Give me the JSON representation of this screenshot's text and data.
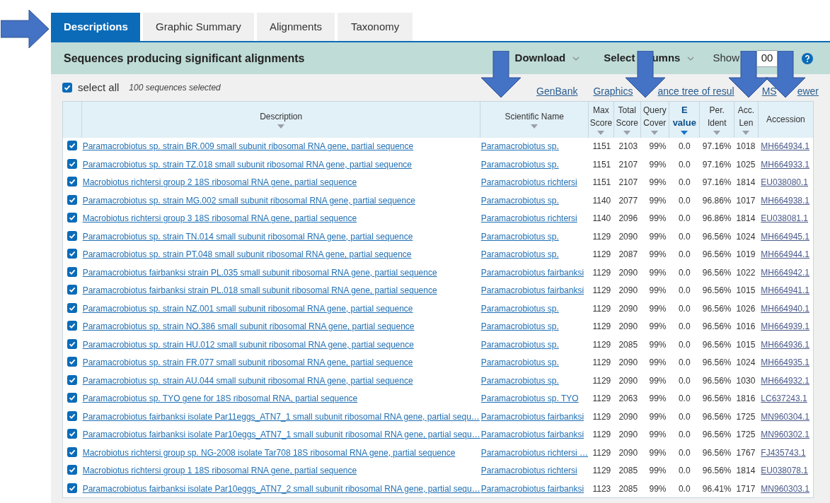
{
  "tabs": [
    {
      "label": "Descriptions",
      "selected": true
    },
    {
      "label": "Graphic Summary",
      "selected": false
    },
    {
      "label": "Alignments",
      "selected": false
    },
    {
      "label": "Taxonomy",
      "selected": false
    }
  ],
  "header": {
    "title": "Sequences producing significant alignments",
    "download": "Download",
    "select_columns": [
      "Select",
      "umns"
    ],
    "show_label": "Show",
    "show_value": "00"
  },
  "select_all": {
    "label": "select all",
    "checked": true,
    "count": "100 sequences selected"
  },
  "links": [
    {
      "parts": [
        "GenBank"
      ]
    },
    {
      "parts": [
        "Graphics"
      ]
    },
    {
      "parts": [
        "ance tree of resul"
      ]
    },
    {
      "parts": [
        "MS",
        "ewer"
      ]
    }
  ],
  "columns": [
    {
      "label": "Description",
      "sortable": true,
      "sorted": false
    },
    {
      "label": "Scientific Name",
      "sortable": true,
      "sorted": false
    },
    {
      "label": "Max Score",
      "sortable": true,
      "sorted": false
    },
    {
      "label": "Total Score",
      "sortable": true,
      "sorted": false
    },
    {
      "label": "Query Cover",
      "sortable": true,
      "sorted": false
    },
    {
      "label": "E value",
      "sortable": true,
      "sorted": true
    },
    {
      "label": "Per. Ident",
      "sortable": true,
      "sorted": false
    },
    {
      "label": "Acc. Len",
      "sortable": true,
      "sorted": false
    },
    {
      "label": "Accession",
      "sortable": false,
      "sorted": false
    }
  ],
  "rows": [
    {
      "checked": true,
      "cells": [
        "Paramacrobiotus sp. strain BR.009 small subunit ribosomal RNA gene, partial sequence",
        "Paramacrobiotus sp.",
        "1151",
        "2103",
        "99%",
        "0.0",
        "97.16%",
        "1018",
        "MH664934.1"
      ]
    },
    {
      "checked": true,
      "cells": [
        "Paramacrobiotus sp. strain TZ.018 small subunit ribosomal RNA gene, partial sequence",
        "Paramacrobiotus sp.",
        "1151",
        "2107",
        "99%",
        "0.0",
        "97.16%",
        "1025",
        "MH664933.1"
      ]
    },
    {
      "checked": true,
      "cells": [
        "Macrobiotus richtersi group 2 18S ribosomal RNA gene, partial sequence",
        "Paramacrobiotus richtersi",
        "1151",
        "2107",
        "99%",
        "0.0",
        "97.16%",
        "1814",
        "EU038080.1"
      ]
    },
    {
      "checked": true,
      "cells": [
        "Paramacrobiotus sp. strain MG.002 small subunit ribosomal RNA gene, partial sequence",
        "Paramacrobiotus sp.",
        "1140",
        "2077",
        "99%",
        "0.0",
        "96.86%",
        "1017",
        "MH664938.1"
      ]
    },
    {
      "checked": true,
      "cells": [
        "Macrobiotus richtersi group 3 18S ribosomal RNA gene, partial sequence",
        "Paramacrobiotus richtersi",
        "1140",
        "2096",
        "99%",
        "0.0",
        "96.86%",
        "1814",
        "EU038081.1"
      ]
    },
    {
      "checked": true,
      "cells": [
        "Paramacrobiotus sp. strain TN.014 small subunit ribosomal RNA gene, partial sequence",
        "Paramacrobiotus sp.",
        "1129",
        "2090",
        "99%",
        "0.0",
        "96.56%",
        "1024",
        "MH664945.1"
      ]
    },
    {
      "checked": true,
      "cells": [
        "Paramacrobiotus sp. strain PT.048 small subunit ribosomal RNA gene, partial sequence",
        "Paramacrobiotus sp.",
        "1129",
        "2087",
        "99%",
        "0.0",
        "96.56%",
        "1019",
        "MH664944.1"
      ]
    },
    {
      "checked": true,
      "cells": [
        "Paramacrobiotus fairbanksi strain PL.035 small subunit ribosomal RNA gene, partial sequence",
        "Paramacrobiotus fairbanksi",
        "1129",
        "2090",
        "99%",
        "0.0",
        "96.56%",
        "1022",
        "MH664942.1"
      ]
    },
    {
      "checked": true,
      "cells": [
        "Paramacrobiotus fairbanksi strain PL.018 small subunit ribosomal RNA gene, partial sequence",
        "Paramacrobiotus fairbanksi",
        "1129",
        "2090",
        "99%",
        "0.0",
        "96.56%",
        "1015",
        "MH664941.1"
      ]
    },
    {
      "checked": true,
      "cells": [
        "Paramacrobiotus sp. strain NZ.001 small subunit ribosomal RNA gene, partial sequence",
        "Paramacrobiotus sp.",
        "1129",
        "2090",
        "99%",
        "0.0",
        "96.56%",
        "1026",
        "MH664940.1"
      ]
    },
    {
      "checked": true,
      "cells": [
        "Paramacrobiotus sp. strain NO.386 small subunit ribosomal RNA gene, partial sequence",
        "Paramacrobiotus sp.",
        "1129",
        "2090",
        "99%",
        "0.0",
        "96.56%",
        "1016",
        "MH664939.1"
      ]
    },
    {
      "checked": true,
      "cells": [
        "Paramacrobiotus sp. strain HU.012 small subunit ribosomal RNA gene, partial sequence",
        "Paramacrobiotus sp.",
        "1129",
        "2085",
        "99%",
        "0.0",
        "96.56%",
        "1015",
        "MH664936.1"
      ]
    },
    {
      "checked": true,
      "cells": [
        "Paramacrobiotus sp. strain FR.077 small subunit ribosomal RNA gene, partial sequence",
        "Paramacrobiotus sp.",
        "1129",
        "2090",
        "99%",
        "0.0",
        "96.56%",
        "1024",
        "MH664935.1"
      ]
    },
    {
      "checked": true,
      "cells": [
        "Paramacrobiotus sp. strain AU.044 small subunit ribosomal RNA gene, partial sequence",
        "Paramacrobiotus sp.",
        "1129",
        "2090",
        "99%",
        "0.0",
        "96.56%",
        "1030",
        "MH664932.1"
      ]
    },
    {
      "checked": true,
      "cells": [
        "Paramacrobiotus sp. TYO gene for 18S ribosomal RNA, partial sequence",
        "Paramacrobiotus sp. TYO",
        "1129",
        "2063",
        "99%",
        "0.0",
        "96.56%",
        "1816",
        "LC637243.1"
      ]
    },
    {
      "checked": true,
      "cells": [
        "Paramacrobiotus fairbanksi isolate Par11eggs_ATN7_1 small subunit ribosomal RNA gene, partial sequ…",
        "Paramacrobiotus fairbanksi",
        "1129",
        "2090",
        "99%",
        "0.0",
        "96.56%",
        "1725",
        "MN960304.1"
      ]
    },
    {
      "checked": true,
      "cells": [
        "Paramacrobiotus fairbanksi isolate Par10eggs_ATN7_1 small subunit ribosomal RNA gene, partial sequ…",
        "Paramacrobiotus fairbanksi",
        "1129",
        "2090",
        "99%",
        "0.0",
        "96.56%",
        "1725",
        "MN960302.1"
      ]
    },
    {
      "checked": true,
      "cells": [
        "Macrobiotus richtersi group sp. NG-2008 isolate Tar708 18S ribosomal RNA gene, partial sequence",
        "Paramacrobiotus richtersi …",
        "1129",
        "2090",
        "99%",
        "0.0",
        "96.56%",
        "1767",
        "FJ435743.1"
      ]
    },
    {
      "checked": true,
      "cells": [
        "Macrobiotus richtersi group 1 18S ribosomal RNA gene, partial sequence",
        "Paramacrobiotus richtersi",
        "1129",
        "2085",
        "99%",
        "0.0",
        "96.56%",
        "1814",
        "EU038078.1"
      ]
    },
    {
      "checked": true,
      "cells": [
        "Paramacrobiotus fairbanksi isolate Par10eggs_ATN7_2 small subunit ribosomal RNA gene, partial sequ…",
        "Paramacrobiotus fairbanksi",
        "1123",
        "2085",
        "99%",
        "0.0",
        "96.41%",
        "1717",
        "MN960303.1"
      ]
    }
  ]
}
